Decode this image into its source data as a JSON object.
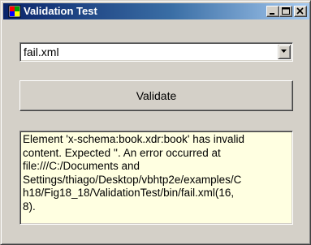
{
  "window": {
    "title": "Validation Test",
    "colors": {
      "title_gradient_start": "#0a246a",
      "title_gradient_end": "#a6caf0",
      "face": "#d4d0c8",
      "output_background": "#ffffe1"
    }
  },
  "file_selector": {
    "selected_value": "fail.xml",
    "arrow_icon": "chevron-down-icon"
  },
  "validate_button": {
    "label": "Validate"
  },
  "output": {
    "text": "Element 'x-schema:book.xdr:book' has invalid\ncontent. Expected ''. An error occurred at\nfile:///C:/Documents and\nSettings/thiago/Desktop/vbhtp2e/examples/C\nh18/Fig18_18/ValidationTest/bin/fail.xml(16,\n8)."
  }
}
